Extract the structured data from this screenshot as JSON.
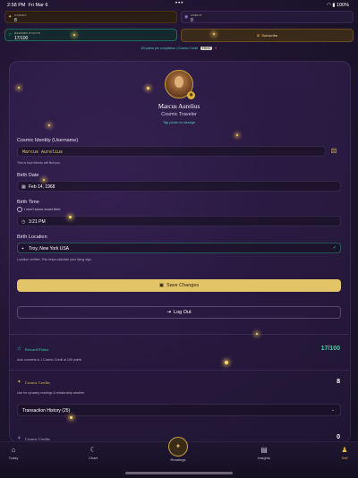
{
  "status_bar": {
    "time": "2:58 PM",
    "date": "Fri Mar 6",
    "battery": "100%"
  },
  "stats": {
    "cosmic": {
      "label": "Cosmic",
      "value": "8",
      "icon": "dice-icon"
    },
    "credit": {
      "label": "Credit",
      "value": "0",
      "icon": "planet-icon"
    },
    "points": {
      "label": "Reward Points",
      "value": "17/100",
      "icon": "star-icon"
    },
    "subscribe_label": "Subscribe"
  },
  "promo": {
    "text": "83 points per completion | Cosmic Credit",
    "badge": "FREE"
  },
  "profile": {
    "name": "Marcus Aurelius",
    "title": "Cosmic Traveler",
    "hint": "Tap photo to change"
  },
  "form": {
    "username_label": "Cosmic Identity (Username)",
    "username_value": "Marcus Aurelius",
    "username_help": "This is how friends will find you.",
    "birth_date_label": "Birth Date",
    "birth_date_value": "Feb 14, 1968",
    "birth_time_label": "Birth Time",
    "unknown_time_label": "I don't know exact time",
    "birth_time_value": "3:21 PM",
    "birth_location_label": "Birth Location",
    "birth_location_value": "Troy, New York USA",
    "location_help": "Location verified. This helps calculate your rising sign."
  },
  "actions": {
    "save_label": "Save Changes",
    "logout_label": "Log Out"
  },
  "sections": {
    "reward": {
      "title": "Reward Points",
      "value": "17/100",
      "help": "Auto converts to 1 Cosmic Credit at 100 points"
    },
    "cosmic": {
      "title": "Cosmic Credits",
      "value": "8",
      "help": "Use for synastry readings & relationship weather",
      "txn_label": "Transaction History (25)"
    },
    "next": {
      "title": "Cosmic Credits",
      "value": "0"
    }
  },
  "tabs": [
    {
      "label": "Today",
      "icon": "home-icon"
    },
    {
      "label": "Chart",
      "icon": "moon-icon"
    },
    {
      "label": "Readings",
      "icon": "dice-icon"
    },
    {
      "label": "Insights",
      "icon": "book-icon"
    },
    {
      "label": "Self",
      "icon": "person-icon"
    }
  ],
  "colors": {
    "accent_gold": "#e3c467",
    "accent_teal": "#3cd1a3",
    "background": "#221634"
  }
}
